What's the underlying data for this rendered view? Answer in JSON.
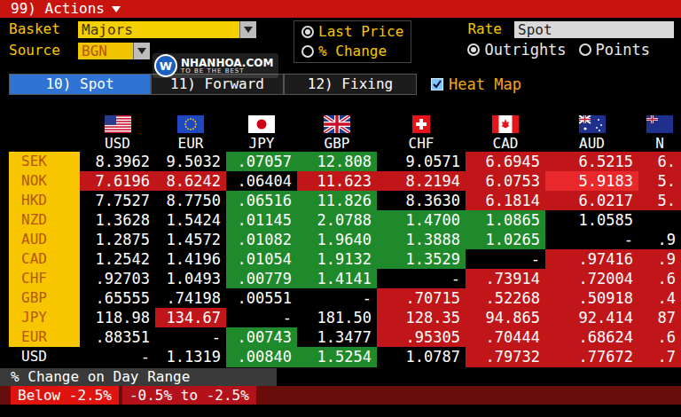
{
  "actions_menu": {
    "label": "99) Actions"
  },
  "basket": {
    "label": "Basket",
    "value": "Majors"
  },
  "source": {
    "label": "Source",
    "value": "BGN"
  },
  "watermark": {
    "mark": "W",
    "name": "NHANHOA.COM",
    "slogan": "TO BE THE BEST"
  },
  "display_options": [
    {
      "label": "Last Price",
      "selected": true
    },
    {
      "label": "% Change",
      "selected": false
    }
  ],
  "rate": {
    "label": "Rate",
    "value": "Spot"
  },
  "quote_options": [
    {
      "label": "Outrights",
      "selected": true
    },
    {
      "label": "Points",
      "selected": false
    }
  ],
  "tabs": [
    {
      "label": "10) Spot",
      "selected": true
    },
    {
      "label": "11) Forward",
      "selected": false
    },
    {
      "label": "12) Fixing",
      "selected": false
    }
  ],
  "heat_map": {
    "label": "Heat Map",
    "checked": true
  },
  "table": {
    "columns": [
      "USD",
      "EUR",
      "JPY",
      "GBP",
      "CHF",
      "CAD",
      "AUD",
      "N"
    ],
    "rows": [
      {
        "label": "SEK",
        "base": false,
        "cells": [
          {
            "value": "8.3962",
            "color": "#000000"
          },
          {
            "value": "9.5032",
            "color": "#000000"
          },
          {
            "value": ".07057",
            "color": "#1f8a2b"
          },
          {
            "value": "12.808",
            "color": "#1f8a2b"
          },
          {
            "value": "9.0571",
            "color": "#000000"
          },
          {
            "value": "6.6945",
            "color": "#c0161a"
          },
          {
            "value": "6.5215",
            "color": "#c0161a"
          },
          {
            "value": "6.",
            "color": "#c0161a"
          }
        ]
      },
      {
        "label": "NOK",
        "base": false,
        "cells": [
          {
            "value": "7.6196",
            "color": "#c0161a"
          },
          {
            "value": "8.6242",
            "color": "#c0161a"
          },
          {
            "value": ".06404",
            "color": "#000000"
          },
          {
            "value": "11.623",
            "color": "#c0161a"
          },
          {
            "value": "8.2194",
            "color": "#c0161a"
          },
          {
            "value": "6.0753",
            "color": "#c0161a"
          },
          {
            "value": "5.9183",
            "color": "#e8282a"
          },
          {
            "value": "5.",
            "color": "#c0161a"
          }
        ]
      },
      {
        "label": "HKD",
        "base": false,
        "cells": [
          {
            "value": "7.7527",
            "color": "#000000"
          },
          {
            "value": "8.7750",
            "color": "#000000"
          },
          {
            "value": ".06516",
            "color": "#1f8a2b"
          },
          {
            "value": "11.826",
            "color": "#1f8a2b"
          },
          {
            "value": "8.3630",
            "color": "#000000"
          },
          {
            "value": "6.1814",
            "color": "#c0161a"
          },
          {
            "value": "6.0217",
            "color": "#c0161a"
          },
          {
            "value": "5.",
            "color": "#c0161a"
          }
        ]
      },
      {
        "label": "NZD",
        "base": false,
        "cells": [
          {
            "value": "1.3628",
            "color": "#000000"
          },
          {
            "value": "1.5424",
            "color": "#000000"
          },
          {
            "value": ".01145",
            "color": "#1f8a2b"
          },
          {
            "value": "2.0788",
            "color": "#1f8a2b"
          },
          {
            "value": "1.4700",
            "color": "#1f8a2b"
          },
          {
            "value": "1.0865",
            "color": "#1f8a2b"
          },
          {
            "value": "1.0585",
            "color": "#000000"
          },
          {
            "value": "",
            "color": "#000000"
          }
        ]
      },
      {
        "label": "AUD",
        "base": false,
        "cells": [
          {
            "value": "1.2875",
            "color": "#000000"
          },
          {
            "value": "1.4572",
            "color": "#000000"
          },
          {
            "value": ".01082",
            "color": "#1f8a2b"
          },
          {
            "value": "1.9640",
            "color": "#1f8a2b"
          },
          {
            "value": "1.3888",
            "color": "#1f8a2b"
          },
          {
            "value": "1.0265",
            "color": "#1f8a2b"
          },
          {
            "value": "-",
            "color": "#000000"
          },
          {
            "value": ".9",
            "color": "#000000"
          }
        ]
      },
      {
        "label": "CAD",
        "base": false,
        "cells": [
          {
            "value": "1.2542",
            "color": "#000000"
          },
          {
            "value": "1.4196",
            "color": "#000000"
          },
          {
            "value": ".01054",
            "color": "#1f8a2b"
          },
          {
            "value": "1.9132",
            "color": "#1f8a2b"
          },
          {
            "value": "1.3529",
            "color": "#1f8a2b"
          },
          {
            "value": "-",
            "color": "#000000"
          },
          {
            "value": ".97416",
            "color": "#c0161a"
          },
          {
            "value": ".9",
            "color": "#c0161a"
          }
        ]
      },
      {
        "label": "CHF",
        "base": false,
        "cells": [
          {
            "value": ".92703",
            "color": "#000000"
          },
          {
            "value": "1.0493",
            "color": "#000000"
          },
          {
            "value": ".00779",
            "color": "#1f8a2b"
          },
          {
            "value": "1.4141",
            "color": "#1f8a2b"
          },
          {
            "value": "-",
            "color": "#000000"
          },
          {
            "value": ".73914",
            "color": "#c0161a"
          },
          {
            "value": ".72004",
            "color": "#c0161a"
          },
          {
            "value": ".6",
            "color": "#c0161a"
          }
        ]
      },
      {
        "label": "GBP",
        "base": false,
        "cells": [
          {
            "value": ".65555",
            "color": "#000000"
          },
          {
            "value": ".74198",
            "color": "#000000"
          },
          {
            "value": ".00551",
            "color": "#000000"
          },
          {
            "value": "-",
            "color": "#000000"
          },
          {
            "value": ".70715",
            "color": "#c0161a"
          },
          {
            "value": ".52268",
            "color": "#c0161a"
          },
          {
            "value": ".50918",
            "color": "#c0161a"
          },
          {
            "value": ".4",
            "color": "#c0161a"
          }
        ]
      },
      {
        "label": "JPY",
        "base": false,
        "cells": [
          {
            "value": "118.98",
            "color": "#000000"
          },
          {
            "value": "134.67",
            "color": "#c0161a"
          },
          {
            "value": "-",
            "color": "#000000"
          },
          {
            "value": "181.50",
            "color": "#000000"
          },
          {
            "value": "128.35",
            "color": "#c0161a"
          },
          {
            "value": "94.865",
            "color": "#c0161a"
          },
          {
            "value": "92.414",
            "color": "#c0161a"
          },
          {
            "value": "87",
            "color": "#c0161a"
          }
        ]
      },
      {
        "label": "EUR",
        "base": false,
        "cells": [
          {
            "value": ".88351",
            "color": "#000000"
          },
          {
            "value": "-",
            "color": "#000000"
          },
          {
            "value": ".00743",
            "color": "#1f8a2b"
          },
          {
            "value": "1.3477",
            "color": "#000000"
          },
          {
            "value": ".95305",
            "color": "#c0161a"
          },
          {
            "value": ".70444",
            "color": "#c0161a"
          },
          {
            "value": ".68624",
            "color": "#c0161a"
          },
          {
            "value": ".6",
            "color": "#c0161a"
          }
        ]
      },
      {
        "label": "USD",
        "base": true,
        "cells": [
          {
            "value": "-",
            "color": "#000000"
          },
          {
            "value": "1.1319",
            "color": "#000000"
          },
          {
            "value": ".00840",
            "color": "#1f8a2b"
          },
          {
            "value": "1.5254",
            "color": "#1f8a2b"
          },
          {
            "value": "1.0787",
            "color": "#000000"
          },
          {
            "value": ".79732",
            "color": "#c0161a"
          },
          {
            "value": ".77672",
            "color": "#c0161a"
          },
          {
            "value": ".7",
            "color": "#c0161a"
          }
        ]
      }
    ]
  },
  "legend": {
    "title": "% Change on Day Range",
    "items": [
      {
        "label": "Below -2.5%",
        "color": "#e0140f"
      },
      {
        "label": "-0.5% to -2.5%",
        "color": "#b3121a"
      }
    ]
  }
}
